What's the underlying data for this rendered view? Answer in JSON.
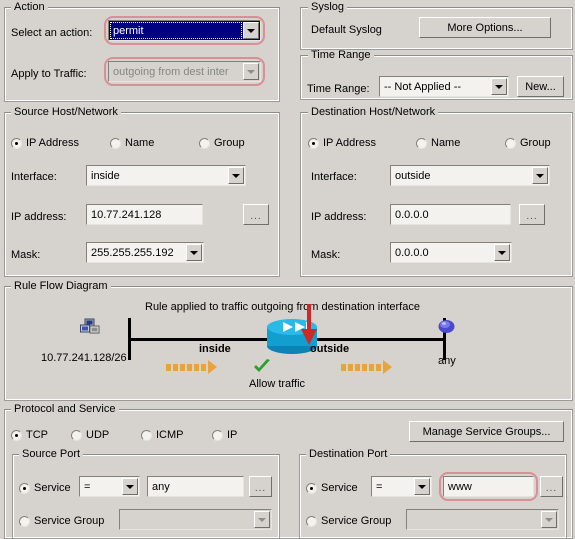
{
  "action": {
    "legend": "Action",
    "select_label": "Select an action:",
    "select_value": "permit",
    "apply_label": "Apply to Traffic:",
    "apply_value": "outgoing from dest inter"
  },
  "syslog": {
    "legend": "Syslog",
    "default_label": "Default Syslog",
    "more_options_button": "More Options..."
  },
  "time_range": {
    "legend": "Time Range",
    "label": "Time Range:",
    "value": "-- Not Applied --",
    "new_button": "New..."
  },
  "source": {
    "legend": "Source Host/Network",
    "radios": [
      {
        "label": "IP Address",
        "selected": true
      },
      {
        "label": "Name",
        "selected": false
      },
      {
        "label": "Group",
        "selected": false
      }
    ],
    "interface_label": "Interface:",
    "interface_value": "inside",
    "ip_label": "IP address:",
    "ip_value": "10.77.241.128",
    "browse_button": "...",
    "mask_label": "Mask:",
    "mask_value": "255.255.255.192"
  },
  "destination": {
    "legend": "Destination Host/Network",
    "radios": [
      {
        "label": "IP Address",
        "selected": true
      },
      {
        "label": "Name",
        "selected": false
      },
      {
        "label": "Group",
        "selected": false
      }
    ],
    "interface_label": "Interface:",
    "interface_value": "outside",
    "ip_label": "IP address:",
    "ip_value": "0.0.0.0",
    "browse_button": "...",
    "mask_label": "Mask:",
    "mask_value": "0.0.0.0"
  },
  "diagram": {
    "legend": "Rule Flow Diagram",
    "caption": "Rule applied to traffic outgoing from destination interface",
    "source_label": "10.77.241.128/26",
    "inside_label": "inside",
    "outside_label": "outside",
    "dest_label": "any",
    "allow_label": "Allow traffic",
    "colors": {
      "router": "#1cabdd",
      "arrow": "#cc2a28",
      "flow": "#e8a33d",
      "check": "#2f9e2f"
    }
  },
  "protocol": {
    "legend": "Protocol and Service",
    "radios": [
      {
        "label": "TCP",
        "selected": true
      },
      {
        "label": "UDP",
        "selected": false
      },
      {
        "label": "ICMP",
        "selected": false
      },
      {
        "label": "IP",
        "selected": false
      }
    ],
    "manage_service_groups_button": "Manage Service Groups..."
  },
  "source_port": {
    "legend": "Source Port",
    "service_radio": "Service",
    "service_selected": true,
    "operator": "=",
    "value": "any",
    "browse_button": "...",
    "group_radio": "Service Group",
    "group_selected": false,
    "group_value": ""
  },
  "destination_port": {
    "legend": "Destination Port",
    "service_radio": "Service",
    "service_selected": true,
    "operator": "=",
    "value": "www",
    "browse_button": "...",
    "group_radio": "Service Group",
    "group_selected": false,
    "group_value": ""
  },
  "highlight_color": "#d98f95"
}
